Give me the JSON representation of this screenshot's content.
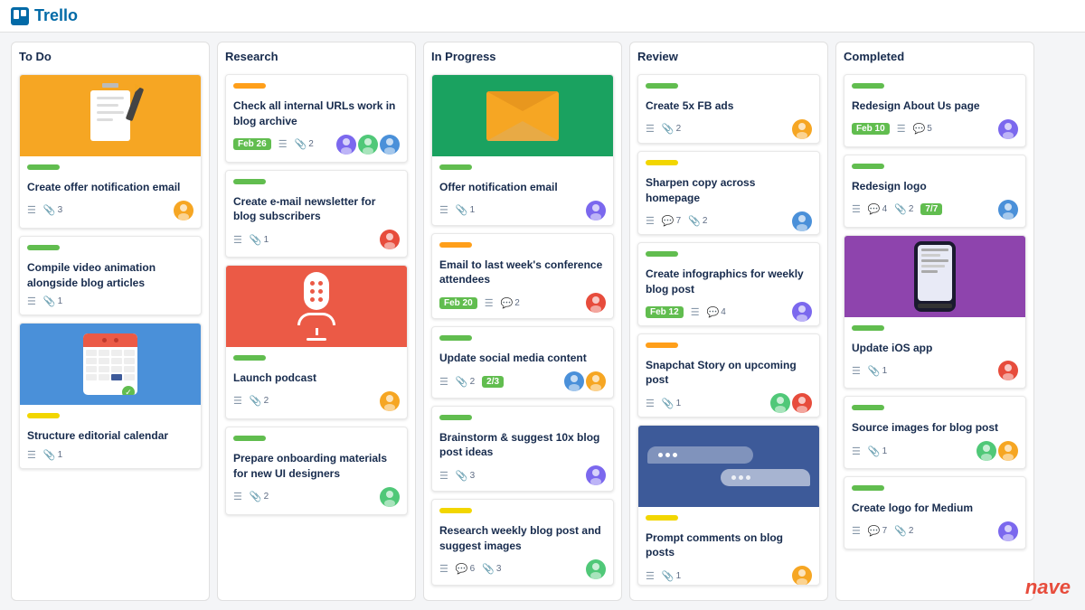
{
  "app": {
    "name": "Trello"
  },
  "columns": [
    {
      "id": "todo",
      "title": "To Do",
      "cards": [
        {
          "id": "todo-1",
          "image": "notepad",
          "label": "green",
          "title": "Create offer notification email",
          "meta": {
            "desc": true,
            "attachments": "3",
            "date": null,
            "comments": null
          },
          "avatars": [
            "a1"
          ]
        },
        {
          "id": "todo-2",
          "image": null,
          "label": "green",
          "title": "Compile video animation alongside blog articles",
          "meta": {
            "desc": true,
            "attachments": "1",
            "date": null,
            "comments": null
          },
          "avatars": []
        },
        {
          "id": "todo-3",
          "image": "calendar",
          "label": "yellow",
          "title": "Structure editorial calendar",
          "meta": {
            "desc": true,
            "attachments": "1",
            "date": null,
            "comments": null
          },
          "avatars": []
        }
      ]
    },
    {
      "id": "research",
      "title": "Research",
      "cards": [
        {
          "id": "res-1",
          "image": null,
          "label": "orange",
          "title": "Check all internal URLs work in blog archive",
          "meta": {
            "desc": true,
            "attachments": "2",
            "date": "Feb 26",
            "comments": null
          },
          "avatars": [
            "a2",
            "a3",
            "a4"
          ]
        },
        {
          "id": "res-2",
          "image": null,
          "label": "green",
          "title": "Create e-mail newsletter for blog subscribers",
          "meta": {
            "desc": true,
            "attachments": "1",
            "date": null,
            "comments": null
          },
          "avatars": [
            "a5"
          ]
        },
        {
          "id": "res-3",
          "image": "microphone",
          "label": "green",
          "title": "Launch podcast",
          "meta": {
            "desc": true,
            "attachments": "2",
            "date": null,
            "comments": null
          },
          "avatars": [
            "a1"
          ]
        },
        {
          "id": "res-4",
          "image": null,
          "label": "green",
          "title": "Prepare onboarding materials for new UI designers",
          "meta": {
            "desc": true,
            "attachments": "2",
            "date": null,
            "comments": null
          },
          "avatars": [
            "a3"
          ]
        }
      ]
    },
    {
      "id": "inprogress",
      "title": "In Progress",
      "cards": [
        {
          "id": "ip-1",
          "image": "envelope",
          "label": "green",
          "title": "Offer notification email",
          "meta": {
            "desc": true,
            "attachments": "1",
            "date": null,
            "comments": null
          },
          "avatars": [
            "a2"
          ]
        },
        {
          "id": "ip-2",
          "image": null,
          "label": "orange",
          "title": "Email to last week's conference attendees",
          "meta": {
            "desc": true,
            "attachments": null,
            "date": "Feb 20",
            "comments": "2"
          },
          "avatars": [
            "a5"
          ]
        },
        {
          "id": "ip-3",
          "image": null,
          "label": "green",
          "title": "Update social media content",
          "meta": {
            "desc": true,
            "attachments": "2",
            "progress": "2/3",
            "date": null,
            "comments": null
          },
          "avatars": [
            "a4",
            "a1"
          ]
        },
        {
          "id": "ip-4",
          "image": null,
          "label": "green",
          "title": "Brainstorm & suggest 10x blog post ideas",
          "meta": {
            "desc": true,
            "attachments": "3",
            "date": null,
            "comments": null
          },
          "avatars": [
            "a2"
          ]
        },
        {
          "id": "ip-5",
          "image": null,
          "label": "yellow",
          "title": "Research weekly blog post and suggest images",
          "meta": {
            "desc": true,
            "attachments": "3",
            "comments": "6",
            "date": null
          },
          "avatars": [
            "a3"
          ]
        }
      ]
    },
    {
      "id": "review",
      "title": "Review",
      "cards": [
        {
          "id": "rv-1",
          "image": null,
          "label": "green",
          "title": "Create 5x FB ads",
          "meta": {
            "desc": true,
            "attachments": "2",
            "date": null,
            "comments": null
          },
          "avatars": [
            "a1"
          ]
        },
        {
          "id": "rv-2",
          "image": null,
          "label": "yellow",
          "title": "Sharpen copy across homepage",
          "meta": {
            "desc": true,
            "attachments": "2",
            "comments": "7",
            "date": null
          },
          "avatars": [
            "a4"
          ]
        },
        {
          "id": "rv-3",
          "image": null,
          "label": "green",
          "title": "Create infographics for weekly blog post",
          "meta": {
            "desc": true,
            "attachments": null,
            "date": "Feb 12",
            "comments": "4"
          },
          "avatars": [
            "a2"
          ]
        },
        {
          "id": "rv-4",
          "image": null,
          "label": "orange",
          "title": "Snapchat Story on upcoming post",
          "meta": {
            "desc": true,
            "attachments": "1",
            "date": null,
            "comments": null
          },
          "avatars": [
            "a3",
            "a5"
          ]
        },
        {
          "id": "rv-5",
          "image": "chat",
          "label": "yellow",
          "title": "Prompt comments on blog posts",
          "meta": {
            "desc": true,
            "attachments": "1",
            "date": null,
            "comments": null
          },
          "avatars": [
            "a1"
          ]
        }
      ]
    },
    {
      "id": "completed",
      "title": "Completed",
      "cards": [
        {
          "id": "cp-1",
          "image": null,
          "label": "green",
          "title": "Redesign About Us page",
          "meta": {
            "desc": true,
            "attachments": null,
            "date": "Feb 10",
            "comments": "5"
          },
          "avatars": [
            "a2"
          ]
        },
        {
          "id": "cp-2",
          "image": null,
          "label": "green",
          "title": "Redesign logo",
          "meta": {
            "desc": true,
            "attachments": "2",
            "comments": "4",
            "progress": "7/7"
          },
          "avatars": [
            "a4"
          ]
        },
        {
          "id": "cp-3",
          "image": "phone",
          "label": "green",
          "title": "Update iOS app",
          "meta": {
            "desc": true,
            "attachments": "1",
            "date": null,
            "comments": null
          },
          "avatars": [
            "a5"
          ]
        },
        {
          "id": "cp-4",
          "image": null,
          "label": "green",
          "title": "Source images for blog post",
          "meta": {
            "desc": true,
            "attachments": "1",
            "date": null,
            "comments": null
          },
          "avatars": [
            "a3",
            "a1"
          ]
        },
        {
          "id": "cp-5",
          "image": null,
          "label": "green",
          "title": "Create logo for Medium",
          "meta": {
            "desc": true,
            "attachments": "2",
            "comments": "7",
            "date": null
          },
          "avatars": [
            "a2"
          ]
        }
      ]
    }
  ]
}
